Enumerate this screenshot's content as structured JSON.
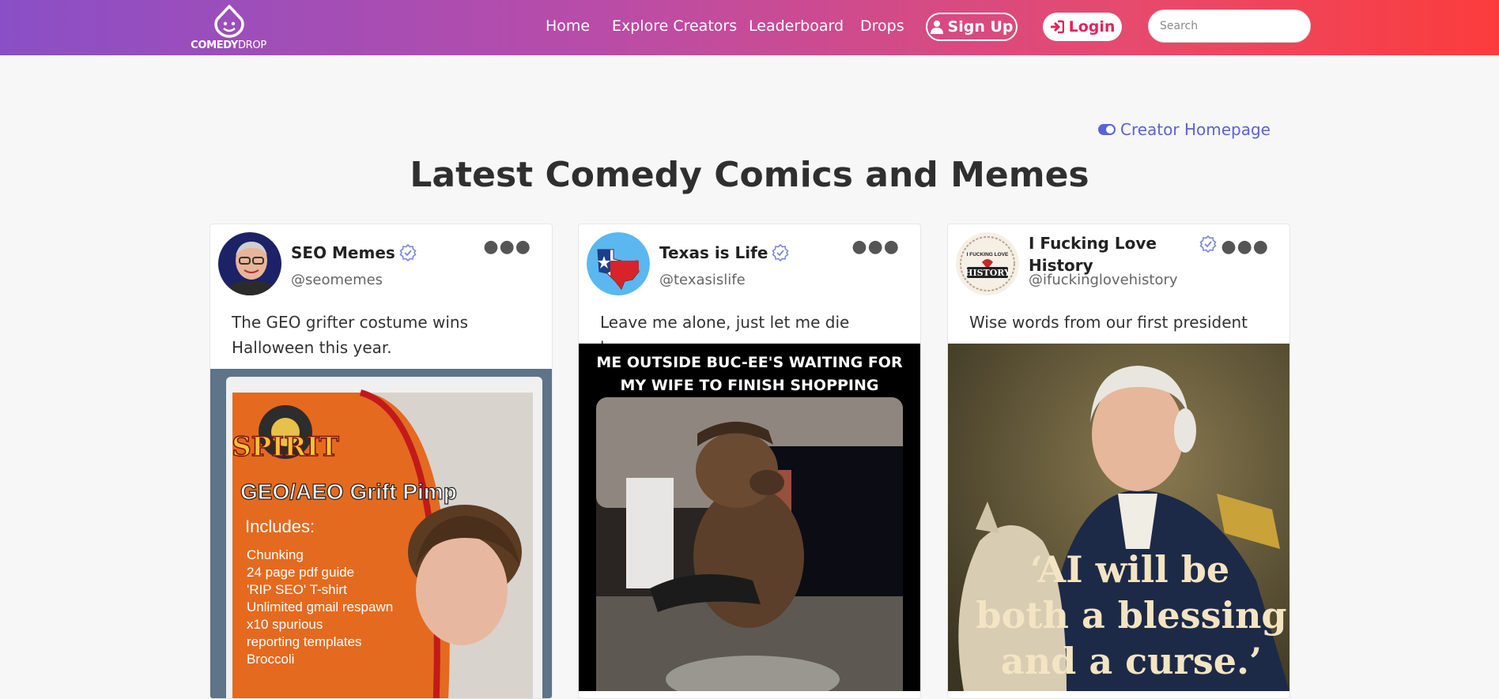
{
  "header": {
    "logo": {
      "main": "COMEDY",
      "rest": "DROP"
    },
    "nav": [
      "Home",
      "Explore Creators",
      "Leaderboard",
      "Drops"
    ],
    "signup": "Sign Up",
    "login": "Login",
    "search_placeholder": "Search",
    "colors": {
      "gradient_start": "#8a4fc6",
      "gradient_end": "#fc3c3c",
      "login_text": "#e2245a"
    }
  },
  "creator_homepage": "Creator Homepage",
  "page_title": "Latest Comedy Comics and Memes",
  "posts": [
    {
      "name": "SEO Memes",
      "handle": "@seomemes",
      "verified": true,
      "caption": "The GEO grifter costume wins Halloween this year.",
      "image_text": {
        "brand": "SPIRIT",
        "product": "GEO/AEO Grift Pimp",
        "includes_label": "Includes:",
        "items": [
          "Chunking",
          "24 page pdf guide",
          "'RIP SEO' T-shirt",
          "Unlimited gmail respawn",
          "x10 spurious",
          "reporting templates",
          "Broccoli"
        ]
      }
    },
    {
      "name": "Texas is Life",
      "handle": "@texasislife",
      "verified": true,
      "caption": "Leave me alone, just let me die here.",
      "image_text": {
        "top_line_1": "ME OUTSIDE BUC-EE'S WAITING FOR",
        "top_line_2": "MY WIFE TO FINISH SHOPPING"
      }
    },
    {
      "name": "I Fucking Love History",
      "handle": "@ifuckinglovehistory",
      "verified": true,
      "caption": "Wise words from our first president",
      "avatar_text": {
        "top": "I FUCKING LOVE",
        "bottom": "HISTORY"
      },
      "image_text": {
        "line_1": "‘AI will be",
        "line_2": "both a blessing",
        "line_3": "and a curse.’"
      }
    }
  ]
}
